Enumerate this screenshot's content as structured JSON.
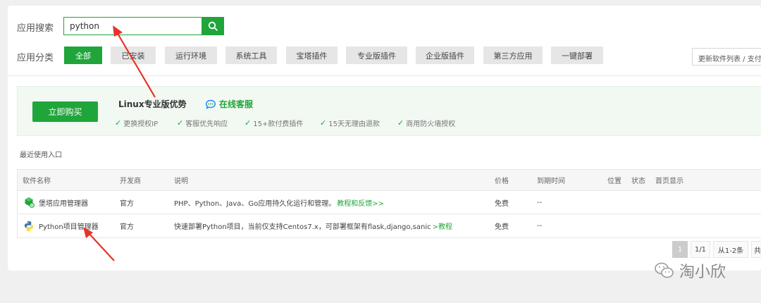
{
  "search": {
    "label": "应用搜索",
    "value": "python"
  },
  "categories": {
    "label": "应用分类",
    "items": [
      "全部",
      "已安装",
      "运行环境",
      "系统工具",
      "宝塔插件",
      "专业版插件",
      "企业版插件",
      "第三方应用",
      "一键部署"
    ],
    "active_index": 0
  },
  "update_text": "更新软件列表 / 支付",
  "promo": {
    "buy_label": "立即购买",
    "title": "Linux专业版优势",
    "service": "在线客服",
    "features": [
      "更换授权IP",
      "客服优先响应",
      "15+款付费插件",
      "15天无理由退款",
      "商用防火墙授权"
    ]
  },
  "recent_label": "最近使用入口",
  "table": {
    "headers": [
      "软件名称",
      "开发商",
      "说明",
      "价格",
      "到期时间",
      "位置",
      "状态",
      "首页显示"
    ],
    "rows": [
      {
        "name": "堡塔应用管理器",
        "vendor": "官方",
        "desc": "PHP、Python、Java、Go应用持久化运行和管理。",
        "link": "教程和反馈>>",
        "price": "免费",
        "expire": "--"
      },
      {
        "name": "Python项目管理器",
        "vendor": "官方",
        "desc": "快速部署Python项目，当前仅支持Centos7.x，可部署框架有flask,django,sanic",
        "link": ">教程",
        "price": "免费",
        "expire": "--"
      }
    ]
  },
  "pagination": {
    "current": "1",
    "total": "1/1",
    "range": "从1-2条",
    "extra": "共"
  },
  "watermark": "淘小欣",
  "colors": {
    "accent": "#20a53a",
    "arrow": "#e8332a"
  }
}
